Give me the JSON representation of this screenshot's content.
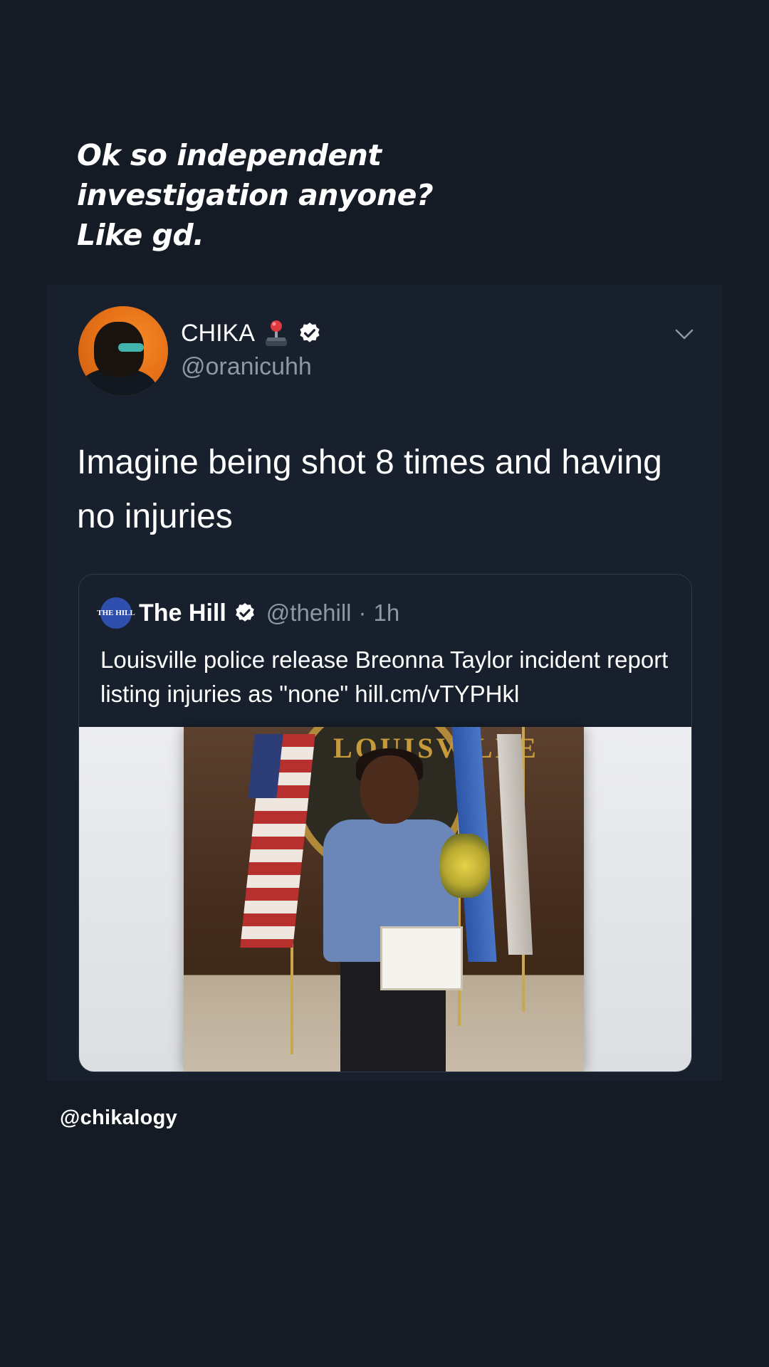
{
  "story": {
    "caption_lines": [
      "Ok so independent",
      "investigation anyone?",
      "Like gd."
    ],
    "footer_mention": "@chikalogy"
  },
  "tweet": {
    "display_name": "CHIKA",
    "emoji_icon": "joystick-icon",
    "verified": true,
    "handle": "@oranicuhh",
    "text": "Imagine being shot 8 times and having no injuries",
    "quoted": {
      "logo_text": "THE HILL",
      "name": "The Hill",
      "handle": "@thehill",
      "time": "1h",
      "separator": "·",
      "text": "Louisville police release Breonna Taylor incident report listing injuries as \"none\" hill.cm/vTYPHkl",
      "seal_text": "LOUISVILLE"
    }
  },
  "colors": {
    "background": "#151b25",
    "card": "#17202c",
    "secondary_text": "#8b98a5",
    "hill_blue": "#2e4fae"
  }
}
